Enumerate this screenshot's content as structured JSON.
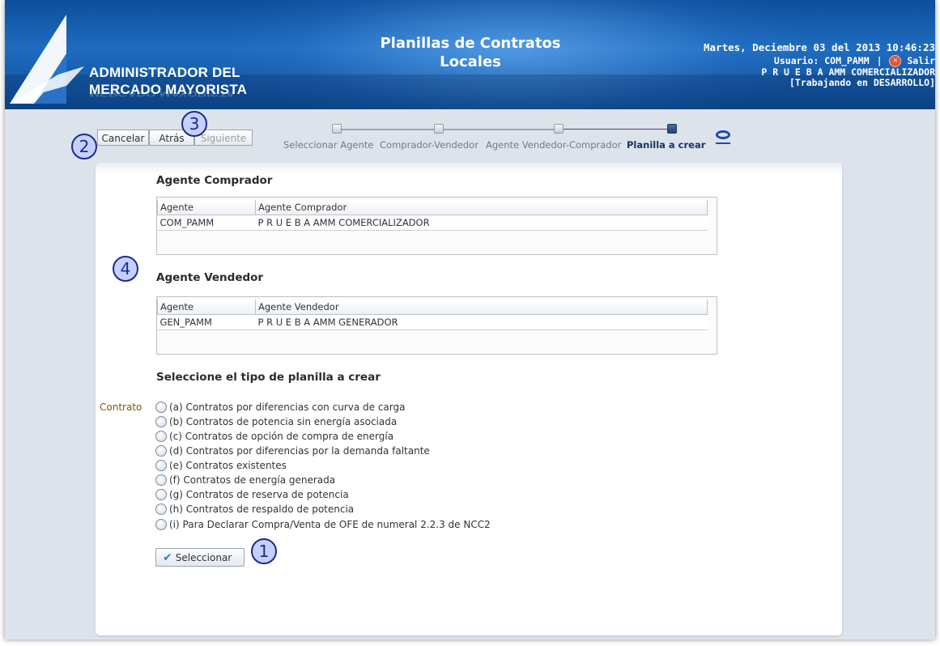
{
  "header": {
    "brand_line1": "ADMINISTRADOR DEL",
    "brand_line2": "MERCADO MAYORISTA",
    "brand_reflection": "MERCADO MAYORISTA",
    "title_line1": "Planillas de Contratos",
    "title_line2": "Locales",
    "date": "Martes, Deciembre 03 del 2013 10:46:23",
    "user_label": "Usuario: COM_PAMM",
    "separator": "|",
    "logout_label": "Salir",
    "company": "P R U E B A AMM COMERCIALIZADOR",
    "environment": "[Trabajando en DESARROLLO]"
  },
  "toolbar": {
    "cancel_label": "Cancelar",
    "back_label": "Atrás",
    "next_label": "Siguiente"
  },
  "train": {
    "steps": [
      "Seleccionar Agente",
      "Comprador-Vendedor",
      "Agente Vendedor-Comprador",
      "Planilla a crear"
    ],
    "current_index": 3
  },
  "buyer": {
    "heading": "Agente Comprador",
    "columns": [
      "Agente",
      "Agente Comprador"
    ],
    "rows": [
      [
        "COM_PAMM",
        "P R U E B A AMM COMERCIALIZADOR"
      ]
    ]
  },
  "seller": {
    "heading": "Agente Vendedor",
    "columns": [
      "Agente",
      "Agente Vendedor"
    ],
    "rows": [
      [
        "GEN_PAMM",
        "P R U E B A AMM GENERADOR"
      ]
    ]
  },
  "selection": {
    "heading": "Seleccione el tipo de planilla a crear",
    "field_label": "Contrato",
    "options": [
      "(a) Contratos por diferencias con curva de carga",
      "(b) Contratos de potencia sin energía asociada",
      "(c) Contratos de opción de compra de energía",
      "(d) Contratos por diferencias por la demanda faltante",
      "(e) Contratos existentes",
      "(f) Contratos de energía generada",
      "(g) Contratos de reserva de potencia",
      "(h) Contratos de respaldo de potencia",
      "(i) Para Declarar Compra/Venta de OFE de numeral 2.2.3 de NCC2"
    ],
    "submit_label": "Seleccionar"
  },
  "callouts": [
    "1",
    "2",
    "3",
    "4"
  ]
}
